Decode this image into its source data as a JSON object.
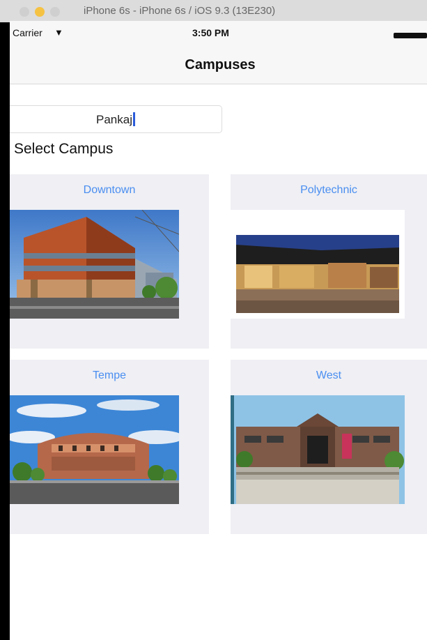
{
  "simulator": {
    "title": "iPhone 6s - iPhone 6s / iOS 9.3 (13E230)"
  },
  "statusbar": {
    "carrier": "Carrier",
    "wifi_icon": "wifi-icon",
    "time": "3:50 PM",
    "battery_icon": "battery-icon"
  },
  "navbar": {
    "title": "Campuses"
  },
  "name_field": {
    "value": "Pankaj"
  },
  "select_label": "Select Campus",
  "campuses": [
    {
      "name": "Downtown"
    },
    {
      "name": "Polytechnic"
    },
    {
      "name": "Tempe"
    },
    {
      "name": "West"
    }
  ],
  "colors": {
    "accent": "#4a8ef0",
    "card_bg": "#efeff4",
    "cursor": "#2b5cd9"
  }
}
